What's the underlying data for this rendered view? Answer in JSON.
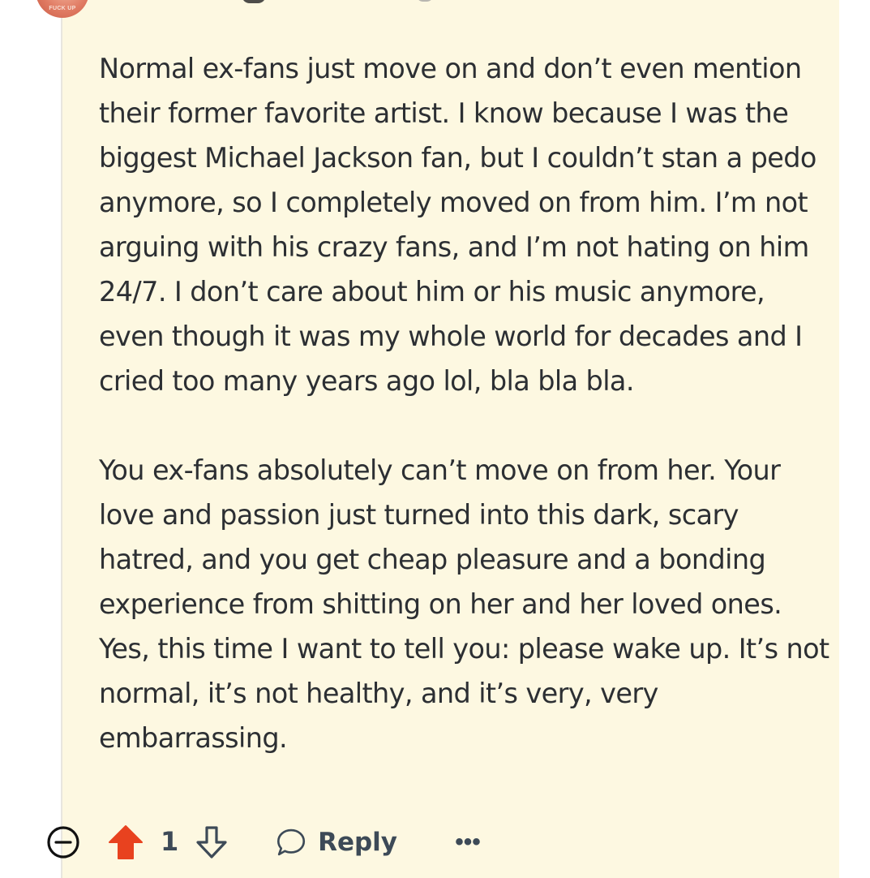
{
  "comment": {
    "avatar_text": "FUCK UP",
    "paragraphs": [
      "Normal ex-fans just move on and don’t even mention their former favorite artist. I know because I was the biggest Michael Jackson fan, but I couldn’t stan a pedo anymore, so I completely moved on from him. I’m not arguing with his crazy fans, and I’m not hating on him 24/7. I don’t care about him or his music anymore, even though it was my whole world for decades and I cried too many years ago lol, bla bla bla.",
      "You ex-fans absolutely can’t move on from her. Your love and passion just turned into this dark, scary hatred, and you get cheap pleasure and a bonding experience from shitting on her and her loved ones. Yes, this time I want to tell you: please wake up. It’s not normal, it’s not healthy, and it’s very, very embarrassing."
    ]
  },
  "actions": {
    "collapse_icon": "minus-circle-icon",
    "upvote_icon": "arrow-up-filled-icon",
    "vote_count": "1",
    "downvote_icon": "arrow-down-outline-icon",
    "reply_icon": "speech-bubble-icon",
    "reply_label": "Reply",
    "more_label": "•••"
  },
  "colors": {
    "comment_background": "#fdf8e1",
    "upvote_active": "#e8421f",
    "text": "#2c2f33",
    "action_text": "#3d4a57"
  }
}
